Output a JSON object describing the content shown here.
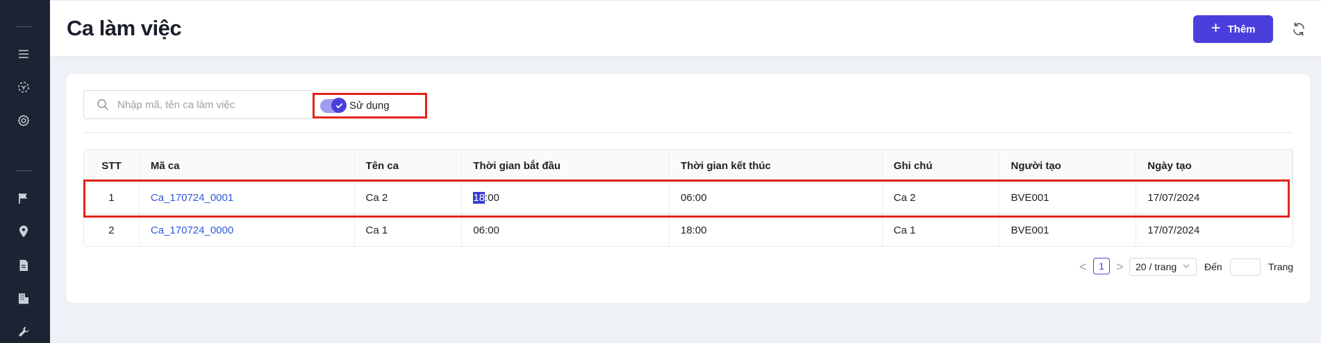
{
  "sidebar": {
    "icons": [
      "menu-icon",
      "dashboard-icon",
      "settings-icon",
      "flag-icon",
      "location-icon",
      "document-icon",
      "building-icon",
      "wrench-icon"
    ]
  },
  "header": {
    "title": "Ca làm việc",
    "add_label": "Thêm"
  },
  "filters": {
    "search_placeholder": "Nhập mã, tên ca làm việc",
    "search_value": "",
    "toggle_label": "Sử dụng",
    "toggle_on": true
  },
  "table": {
    "columns": [
      "STT",
      "Mã ca",
      "Tên ca",
      "Thời gian bắt đầu",
      "Thời gian kết thúc",
      "Ghi chú",
      "Người tạo",
      "Ngày tạo"
    ],
    "rows": [
      {
        "stt": "1",
        "code": "Ca_170724_0001",
        "name": "Ca 2",
        "start_sel": "18",
        "start_rest": ":00",
        "end": "06:00",
        "note": "Ca 2",
        "creator": "BVE001",
        "date": "17/07/2024"
      },
      {
        "stt": "2",
        "code": "Ca_170724_0000",
        "name": "Ca 1",
        "start_sel": "",
        "start_rest": "06:00",
        "end": "18:00",
        "note": "Ca 1",
        "creator": "BVE001",
        "date": "17/07/2024"
      }
    ]
  },
  "pagination": {
    "prev": "<",
    "current": "1",
    "next": ">",
    "page_size": "20 / trang",
    "goto_label": "Đến",
    "page_label": "Trang"
  },
  "colors": {
    "primary": "#4a3fdc",
    "sidebar_bg": "#1c2433",
    "link": "#2c59d8",
    "annotation": "#e2231a"
  }
}
